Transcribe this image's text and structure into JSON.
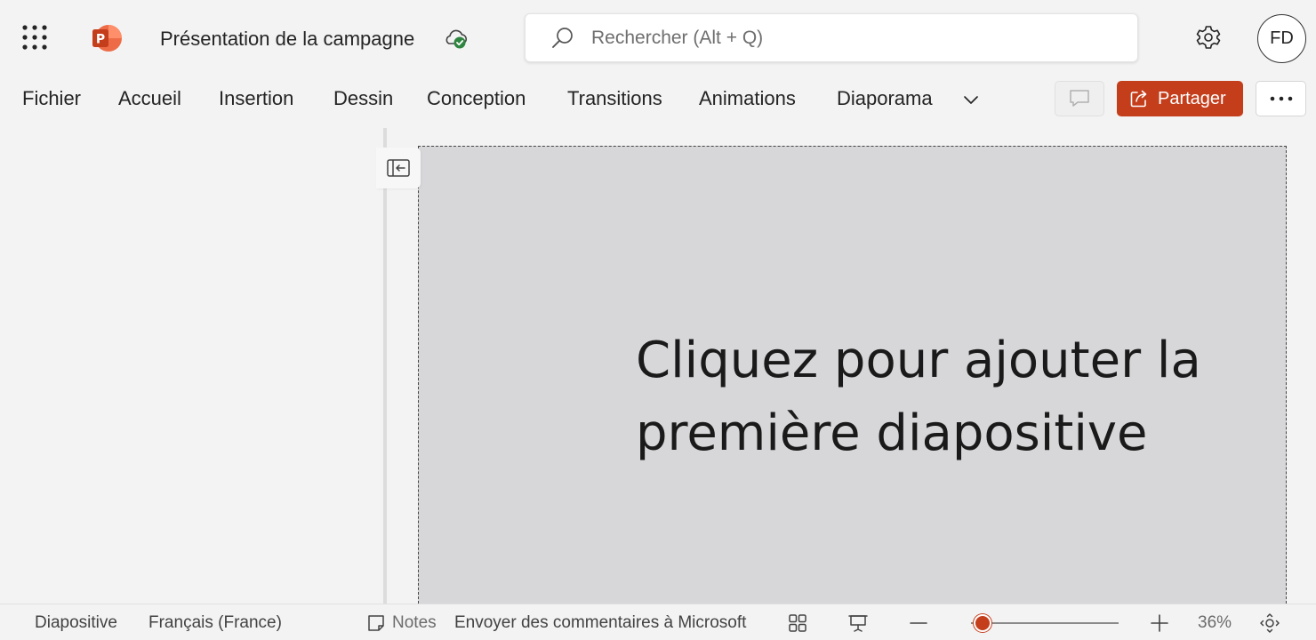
{
  "header": {
    "doc_title": "Présentation de la campagne",
    "search_placeholder": "Rechercher (Alt + Q)",
    "avatar_initials": "FD",
    "app_icon": "powerpoint-logo",
    "app_letter": "P"
  },
  "ribbon": {
    "tabs": [
      "Fichier",
      "Accueil",
      "Insertion",
      "Dessin",
      "Conception",
      "Transitions",
      "Animations",
      "Diaporama"
    ],
    "share_label": "Partager"
  },
  "slide": {
    "prompt_line1": "Cliquez pour ajouter la",
    "prompt_line2": "première diapositive"
  },
  "status": {
    "slide_label": "Diapositive",
    "language": "Français (France)",
    "notes_label": "Notes",
    "feedback": "Envoyer des commentaires à Microsoft",
    "zoom_level": "36%",
    "zoom_fraction": 0.08
  },
  "colors": {
    "accent": "#c43e1c",
    "background": "#f3f3f3",
    "slide_bg": "#d7d7da",
    "cloud_check": "#2e8540"
  }
}
